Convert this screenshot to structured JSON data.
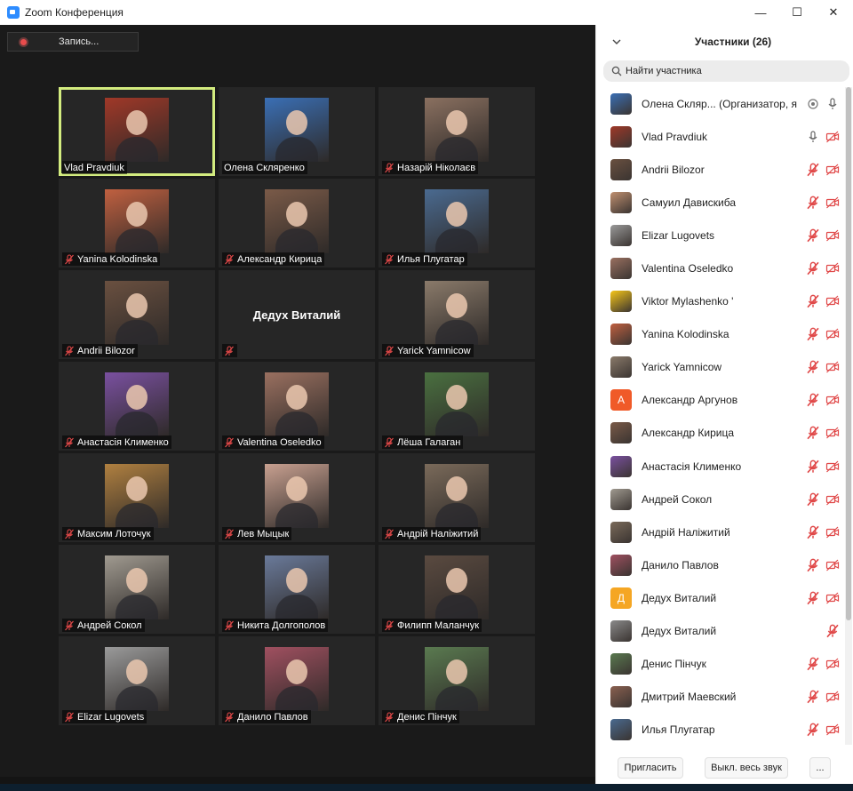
{
  "window": {
    "title": "Zoom Конференция",
    "controls": {
      "minimize": "—",
      "maximize": "☐",
      "close": "✕"
    }
  },
  "meeting": {
    "record_label": "Запись...",
    "tiles": [
      {
        "name": "Vlad Pravdiuk",
        "muted": false,
        "active": true,
        "video": true,
        "color": "#a03828"
      },
      {
        "name": "Олена Скляренко",
        "muted": false,
        "active": false,
        "video": true,
        "color": "#3a6fb5"
      },
      {
        "name": "Назарій Ніколаєв",
        "muted": true,
        "active": false,
        "video": true,
        "color": "#8a7060"
      },
      {
        "name": "Yanina Kolodinska",
        "muted": true,
        "active": false,
        "video": true,
        "color": "#c06040"
      },
      {
        "name": "Александр Кирица",
        "muted": true,
        "active": false,
        "video": true,
        "color": "#7a5a48"
      },
      {
        "name": "Илья Плугатар",
        "muted": true,
        "active": false,
        "video": true,
        "color": "#4a6a90"
      },
      {
        "name": "Andrii Bilozor",
        "muted": true,
        "active": false,
        "video": true,
        "color": "#6a5040"
      },
      {
        "name": "Дедух Виталий",
        "muted": true,
        "active": false,
        "video": false,
        "color": "#262626"
      },
      {
        "name": "Yarick Yamnicow",
        "muted": true,
        "active": false,
        "video": true,
        "color": "#8a7a6a"
      },
      {
        "name": "Анастасія Клименко",
        "muted": true,
        "active": false,
        "video": true,
        "color": "#7a50a0"
      },
      {
        "name": "Valentina Oseledko",
        "muted": true,
        "active": false,
        "video": true,
        "color": "#9a7060"
      },
      {
        "name": "Лёша Галаган",
        "muted": true,
        "active": false,
        "video": true,
        "color": "#4a7040"
      },
      {
        "name": "Максим Лоточук",
        "muted": true,
        "active": false,
        "video": true,
        "color": "#b08040"
      },
      {
        "name": "Лев Мыцык",
        "muted": true,
        "active": false,
        "video": true,
        "color": "#c8a090"
      },
      {
        "name": "Андрій Наліжитий",
        "muted": true,
        "active": false,
        "video": true,
        "color": "#7a6a5a"
      },
      {
        "name": "Андрей Сокол",
        "muted": true,
        "active": false,
        "video": true,
        "color": "#a09a90"
      },
      {
        "name": "Никита Долгополов",
        "muted": true,
        "active": false,
        "video": true,
        "color": "#6a7a9a"
      },
      {
        "name": "Филипп Маланчук",
        "muted": true,
        "active": false,
        "video": true,
        "color": "#5a4a40"
      },
      {
        "name": "Elizar Lugovets",
        "muted": true,
        "active": false,
        "video": true,
        "color": "#9a9a9a"
      },
      {
        "name": "Данило Павлов",
        "muted": true,
        "active": false,
        "video": true,
        "color": "#a05060"
      },
      {
        "name": "Денис Пінчук",
        "muted": true,
        "active": false,
        "video": true,
        "color": "#5a7a50"
      }
    ]
  },
  "panel": {
    "title": "Участники (26)",
    "search_placeholder": "Найти участника",
    "participants": [
      {
        "name": "Олена Скляр...  (Организатор, я)",
        "mic": "on",
        "video": "none",
        "host": true,
        "color": "#3a6fb5",
        "letter": ""
      },
      {
        "name": "Vlad Pravdiuk",
        "mic": "on",
        "video": "off",
        "host": false,
        "color": "#a03828",
        "letter": ""
      },
      {
        "name": "Andrii Bilozor",
        "mic": "muted",
        "video": "off",
        "host": false,
        "color": "#6a5040",
        "letter": ""
      },
      {
        "name": "Самуил Давискиба",
        "mic": "muted",
        "video": "off",
        "host": false,
        "color": "#c09070",
        "letter": ""
      },
      {
        "name": "Elizar Lugovets",
        "mic": "muted",
        "video": "off",
        "host": false,
        "color": "#9a9a9a",
        "letter": ""
      },
      {
        "name": "Valentina Oseledko",
        "mic": "muted",
        "video": "off",
        "host": false,
        "color": "#9a7060",
        "letter": ""
      },
      {
        "name": "Viktor Mylashenko '",
        "mic": "muted",
        "video": "off",
        "host": false,
        "color": "#f5c518",
        "letter": ""
      },
      {
        "name": "Yanina Kolodinska",
        "mic": "muted",
        "video": "off",
        "host": false,
        "color": "#c06040",
        "letter": ""
      },
      {
        "name": "Yarick Yamnicow",
        "mic": "muted",
        "video": "off",
        "host": false,
        "color": "#8a7a6a",
        "letter": ""
      },
      {
        "name": "Александр Аргунов",
        "mic": "muted",
        "video": "off",
        "host": false,
        "color": "#f05a28",
        "letter": "А"
      },
      {
        "name": "Александр Кирица",
        "mic": "muted",
        "video": "off",
        "host": false,
        "color": "#7a5a48",
        "letter": ""
      },
      {
        "name": "Анастасія Клименко",
        "mic": "muted",
        "video": "off",
        "host": false,
        "color": "#7a50a0",
        "letter": ""
      },
      {
        "name": "Андрей Сокол",
        "mic": "muted",
        "video": "off",
        "host": false,
        "color": "#a09a90",
        "letter": ""
      },
      {
        "name": "Андрій Наліжитий",
        "mic": "muted",
        "video": "off",
        "host": false,
        "color": "#7a6a5a",
        "letter": ""
      },
      {
        "name": "Данило Павлов",
        "mic": "muted",
        "video": "off",
        "host": false,
        "color": "#a05060",
        "letter": ""
      },
      {
        "name": "Дедух Виталий",
        "mic": "muted",
        "video": "off",
        "host": false,
        "color": "#f5a623",
        "letter": "Д"
      },
      {
        "name": "Дедух Виталий",
        "mic": "muted",
        "video": "none",
        "host": false,
        "color": "#8a8a8a",
        "letter": ""
      },
      {
        "name": "Денис Пінчук",
        "mic": "muted",
        "video": "off",
        "host": false,
        "color": "#5a7a50",
        "letter": ""
      },
      {
        "name": "Дмитрий Маевский",
        "mic": "muted",
        "video": "off",
        "host": false,
        "color": "#8a6050",
        "letter": ""
      },
      {
        "name": "Илья Плугатар",
        "mic": "muted",
        "video": "off",
        "host": false,
        "color": "#4a6a90",
        "letter": ""
      }
    ],
    "footer": {
      "invite_label": "Пригласить",
      "mute_all_label": "Выкл. весь звук",
      "more_label": "..."
    }
  },
  "colors": {
    "meeting_bg": "#1a1a1a",
    "tile_bg": "#262626",
    "active_border": "#d3ec7f",
    "muted_red": "#e04848"
  }
}
